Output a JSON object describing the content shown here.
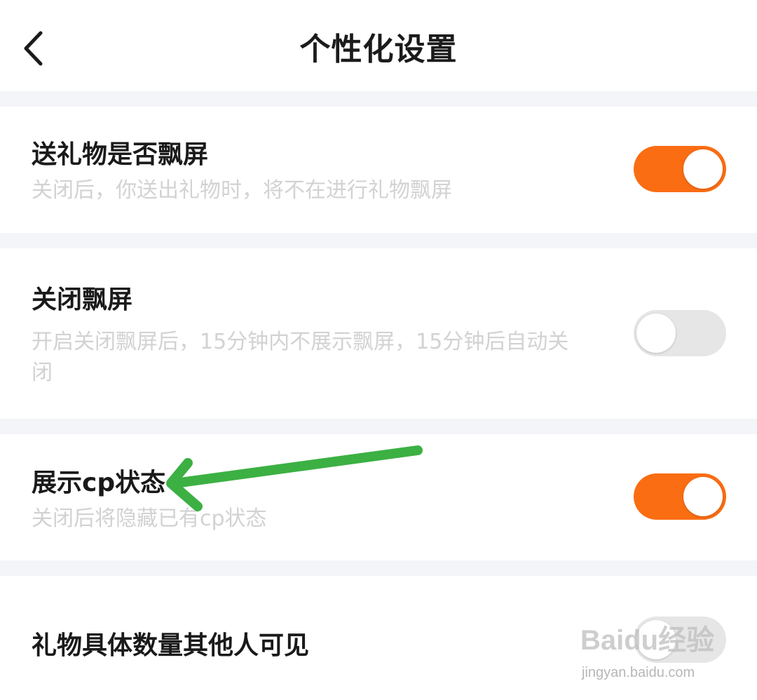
{
  "header": {
    "title": "个性化设置",
    "back_icon": "chevron-left-icon"
  },
  "settings": [
    {
      "title": "送礼物是否飘屏",
      "description": "关闭后，你送出礼物时，将不在进行礼物飘屏",
      "enabled": true
    },
    {
      "title": "关闭飘屏",
      "description": "开启关闭飘屏后，15分钟内不展示飘屏，15分钟后自动关闭",
      "enabled": false
    },
    {
      "title": "展示cp状态",
      "description": "关闭后将隐藏已有cp状态",
      "enabled": true
    },
    {
      "title": "礼物具体数量其他人可见",
      "description": "",
      "enabled": false
    }
  ],
  "annotation": {
    "arrow_color": "#3cb043",
    "points_to": "展示cp状态"
  },
  "watermark": {
    "brand": "Baidu经验",
    "url": "jingyan.baidu.com"
  },
  "colors": {
    "accent": "#fa6d13",
    "toggle_off": "#e6e6e6",
    "section_gap": "#f3f5f8",
    "description_text": "#d2d2d2"
  }
}
